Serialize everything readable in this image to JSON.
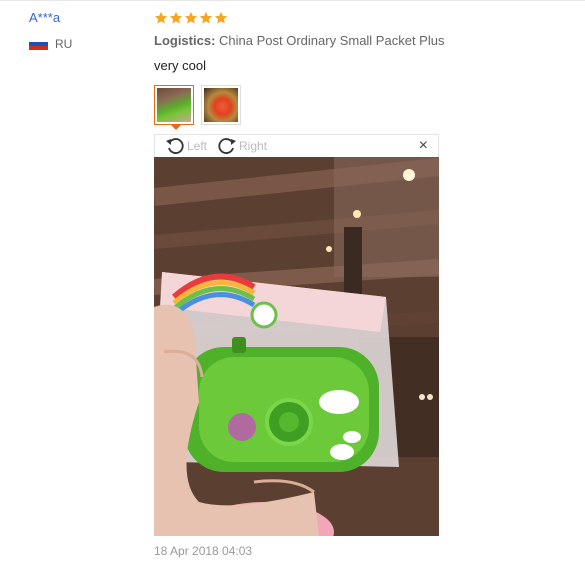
{
  "buyer": {
    "name": "A***a",
    "country": "RU",
    "flag_colors": [
      "#ffffff",
      "#1f4fb5",
      "#d52b1e"
    ]
  },
  "review": {
    "rating": 5,
    "star_color": "#f5a623",
    "logistics_label": "Logistics:",
    "logistics_value": "China Post Ordinary Small Packet Plus",
    "comment": "very cool",
    "date": "18 Apr 2018 04:03"
  },
  "viewer": {
    "rotate_left_label": "Left",
    "rotate_right_label": "Right",
    "rotate_left_icon": "rotate-left-icon",
    "rotate_right_icon": "rotate-right-icon",
    "close_icon": "close-icon",
    "close_glyph": "×",
    "accent_color": "#e96b10"
  },
  "thumbnails": [
    {
      "name": "thumbnail-1",
      "selected": true
    },
    {
      "name": "thumbnail-2",
      "selected": false
    }
  ]
}
